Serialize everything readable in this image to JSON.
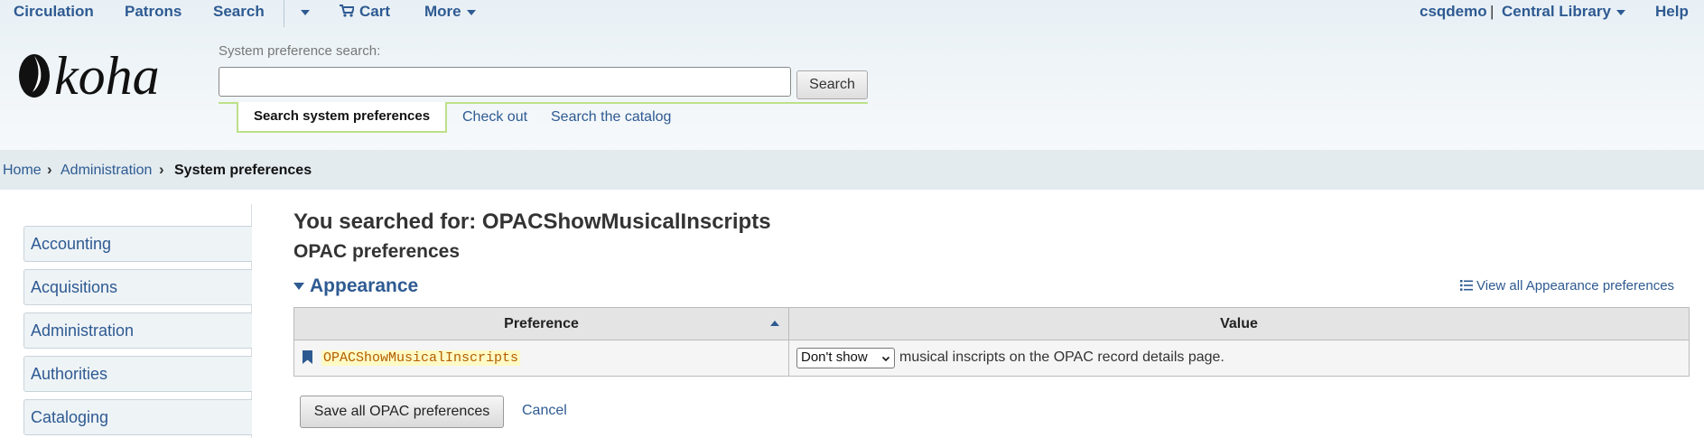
{
  "topnav": {
    "circulation": "Circulation",
    "patrons": "Patrons",
    "search": "Search",
    "cart": "Cart",
    "more": "More",
    "user": "csqdemo",
    "separator": "|",
    "library": "Central Library",
    "help": "Help"
  },
  "prefsearch": {
    "label": "System preference search:",
    "value": "",
    "button": "Search",
    "tabs": [
      "Search system preferences",
      "Check out",
      "Search the catalog"
    ]
  },
  "breadcrumbs": [
    "Home",
    "Administration",
    "System preferences"
  ],
  "sidebar": {
    "items": [
      "Accounting",
      "Acquisitions",
      "Administration",
      "Authorities",
      "Cataloging"
    ]
  },
  "main": {
    "title": "You searched for: OPACShowMusicalInscripts",
    "section": "OPAC preferences",
    "group": "Appearance",
    "view_all": "View all Appearance preferences",
    "table": {
      "headers": [
        "Preference",
        "Value"
      ],
      "rows": [
        {
          "name": "OPACShowMusicalInscripts",
          "select_value": "Don't show",
          "description": "musical inscripts on the OPAC record details page."
        }
      ]
    },
    "save_button": "Save all OPAC preferences",
    "cancel": "Cancel"
  },
  "colors": {
    "link": "#2e5a92",
    "header_bg": "#e8f0f5",
    "active_tab_border": "#bde08a",
    "pref_name_highlight": "#fffac4"
  }
}
